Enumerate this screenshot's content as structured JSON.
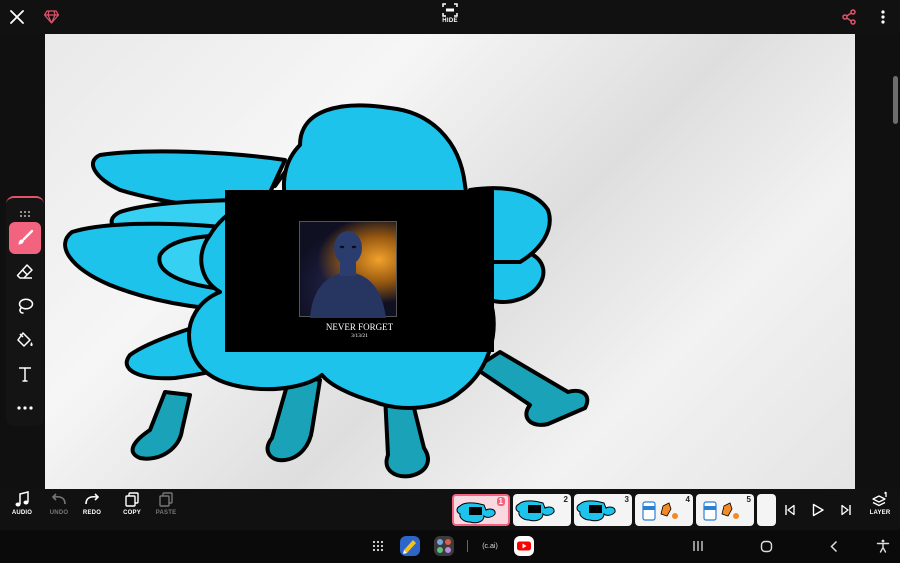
{
  "top": {
    "hide_label": "HIDE"
  },
  "bottom": {
    "audio": "AUDIO",
    "undo": "UNDO",
    "redo": "REDO",
    "copy": "COPY",
    "paste": "PASTE",
    "layer": "LAYER"
  },
  "frames": [
    {
      "num": "1",
      "active": true
    },
    {
      "num": "2"
    },
    {
      "num": "3"
    },
    {
      "num": "4"
    },
    {
      "num": "5"
    }
  ],
  "canvas": {
    "news_title": "NEVER FORGET",
    "news_date": "3/13/21"
  },
  "navbar": {
    "cai": "(c.ai)"
  },
  "colors": {
    "accent": "#f2637f",
    "blob_main": "#1ec3ec",
    "blob_light": "#35d0f2",
    "blob_dark": "#1aa3b8",
    "gem": "#e0536a"
  }
}
